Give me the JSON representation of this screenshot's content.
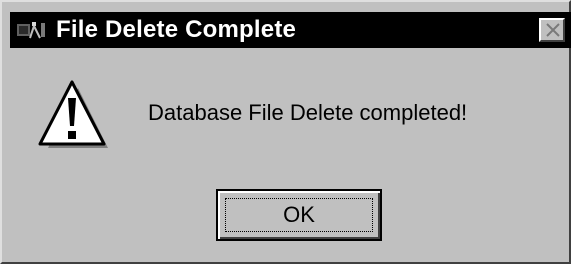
{
  "window": {
    "title": "File Delete Complete",
    "app_icon": "app-icon",
    "close_icon": "close-icon",
    "colors": {
      "dialog_bg": "#c0c0c0",
      "titlebar_bg": "#000000",
      "titlebar_text": "#ffffff"
    }
  },
  "body": {
    "icon": "warning-icon",
    "message": "Database File Delete completed!"
  },
  "buttons": {
    "ok_label": "OK"
  }
}
